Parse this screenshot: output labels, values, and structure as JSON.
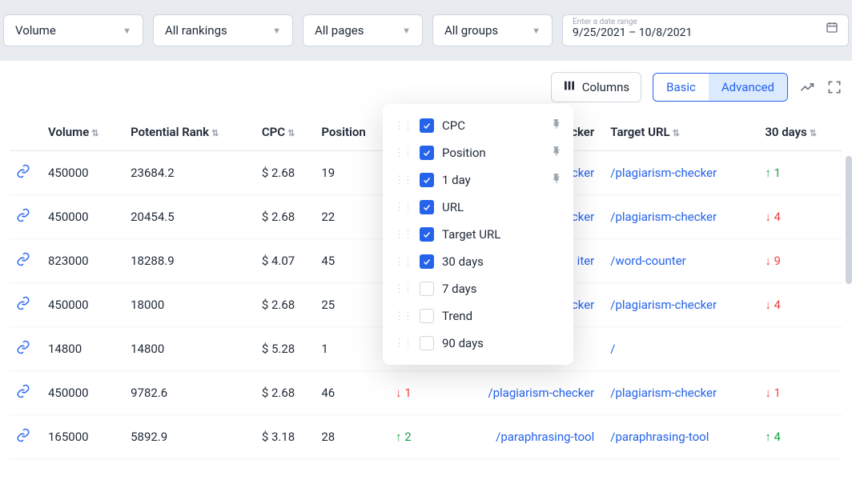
{
  "filters": {
    "volume": "Volume",
    "rankings": "All rankings",
    "pages": "All pages",
    "groups": "All groups",
    "date_hint": "Enter a date range",
    "date_value": "9/25/2021 – 10/8/2021"
  },
  "toolbar": {
    "columns": "Columns",
    "basic": "Basic",
    "advanced": "Advanced"
  },
  "headers": {
    "volume": "Volume",
    "potential_rank": "Potential Rank",
    "cpc": "CPC",
    "position": "Position",
    "url_partial": "-checker",
    "target_url": "Target URL",
    "days30": "30 days"
  },
  "rows": [
    {
      "volume": "450000",
      "rank": "23684.2",
      "cpc": "$ 2.68",
      "pos": "19",
      "url": "-checker",
      "target": "/plagiarism-checker",
      "d30": {
        "dir": "up",
        "val": "1"
      }
    },
    {
      "volume": "450000",
      "rank": "20454.5",
      "cpc": "$ 2.68",
      "pos": "22",
      "url": "-checker",
      "target": "/plagiarism-checker",
      "d30": {
        "dir": "down",
        "val": "4"
      }
    },
    {
      "volume": "823000",
      "rank": "18288.9",
      "cpc": "$ 4.07",
      "pos": "45",
      "url": "iter",
      "target": "/word-counter",
      "d30": {
        "dir": "down",
        "val": "9"
      }
    },
    {
      "volume": "450000",
      "rank": "18000",
      "cpc": "$ 2.68",
      "pos": "25",
      "url": "-checker",
      "target": "/plagiarism-checker",
      "d30": {
        "dir": "down",
        "val": "4"
      }
    },
    {
      "volume": "14800",
      "rank": "14800",
      "cpc": "$ 5.28",
      "pos": "1",
      "url": "",
      "target": "/",
      "d30": {
        "dir": "",
        "val": ""
      }
    },
    {
      "volume": "450000",
      "rank": "9782.6",
      "cpc": "$ 2.68",
      "pos": "46",
      "d1": {
        "dir": "down",
        "val": "1"
      },
      "url": "/plagiarism-checker",
      "target": "/plagiarism-checker",
      "d30": {
        "dir": "down",
        "val": "1"
      }
    },
    {
      "volume": "165000",
      "rank": "5892.9",
      "cpc": "$ 3.18",
      "pos": "28",
      "d1": {
        "dir": "up",
        "val": "2"
      },
      "url": "/paraphrasing-tool",
      "target": "/paraphrasing-tool",
      "d30": {
        "dir": "up",
        "val": "4"
      }
    }
  ],
  "column_options": [
    {
      "label": "CPC",
      "checked": true,
      "pinned": true
    },
    {
      "label": "Position",
      "checked": true,
      "pinned": true
    },
    {
      "label": "1 day",
      "checked": true,
      "pinned": true
    },
    {
      "label": "URL",
      "checked": true,
      "pinned": false
    },
    {
      "label": "Target URL",
      "checked": true,
      "pinned": false
    },
    {
      "label": "30 days",
      "checked": true,
      "pinned": false
    },
    {
      "label": "7 days",
      "checked": false,
      "pinned": false
    },
    {
      "label": "Trend",
      "checked": false,
      "pinned": false
    },
    {
      "label": "90 days",
      "checked": false,
      "pinned": false
    }
  ]
}
